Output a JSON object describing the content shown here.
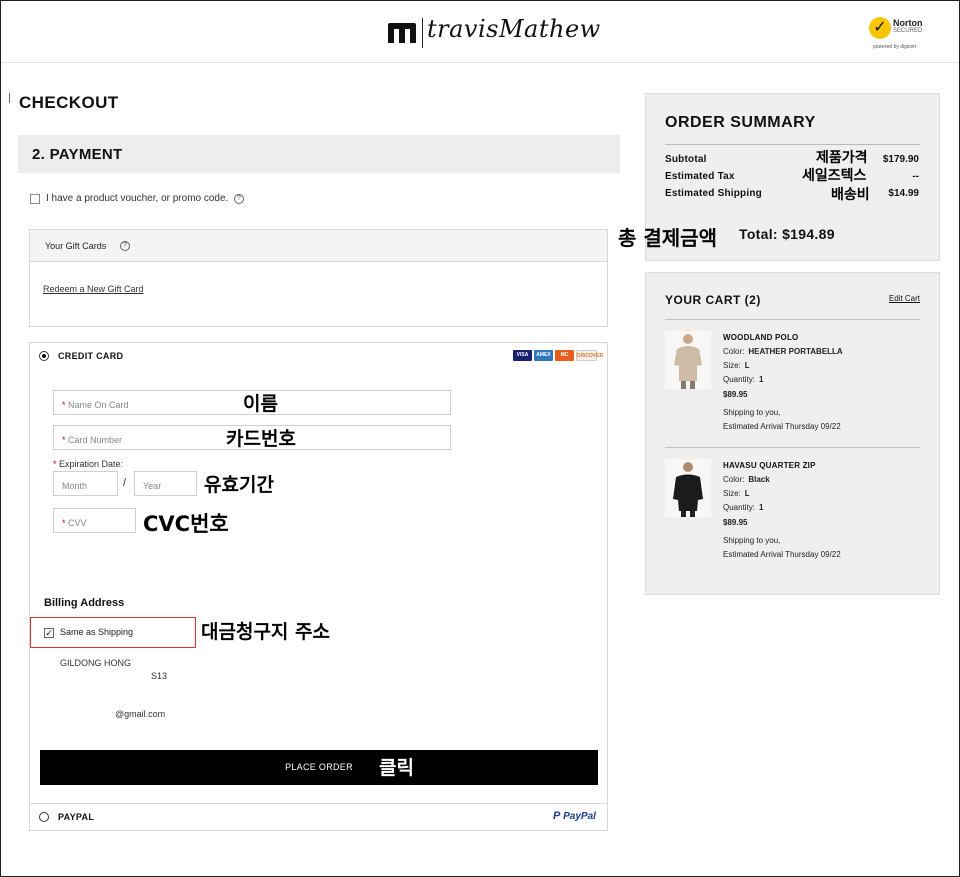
{
  "header": {
    "brand": "travisMathew",
    "norton_badge": {
      "line1": "Norton",
      "line2": "SECURED",
      "powered": "powered by digicert"
    },
    "accent_color": "#f7c600"
  },
  "checkout": {
    "title": "CHECKOUT",
    "step_title": "2. PAYMENT",
    "promo_label": "I have a product voucher, or promo code.",
    "gift_cards": {
      "header": "Your Gift Cards",
      "redeem_link": "Redeem a New Gift Card"
    },
    "credit_card": {
      "label": "CREDIT CARD",
      "selected": true,
      "card_brands": [
        "VISA",
        "AMEX",
        "MC",
        "DISCOVER"
      ],
      "fields": {
        "name_placeholder": "Name On Card",
        "number_placeholder": "Card Number",
        "expiration_label": "Expiration Date:",
        "month_placeholder": "Month",
        "year_placeholder": "Year",
        "date_separator": "/",
        "cvv_placeholder": "CVV",
        "required_mark": "*"
      }
    },
    "billing": {
      "title": "Billing Address",
      "same_as_shipping_label": "Same as Shipping",
      "same_as_shipping_checked": true,
      "name": "GILDONG HONG",
      "line2": "S13",
      "email": "@gmail.com"
    },
    "place_order_label": "PLACE ORDER",
    "paypal": {
      "label": "PAYPAL",
      "logo_text": "PayPal",
      "selected": false
    }
  },
  "annotations": {
    "name": "이름",
    "card_number": "카드번호",
    "expiry": "유효기간",
    "cvc": "CVC번호",
    "billing_address": "대금청구지 주소",
    "click": "클릭",
    "product_price": "제품가격",
    "sales_tax": "세일즈텍스",
    "shipping_fee": "배송비",
    "total_amount": "총 결제금액"
  },
  "order_summary": {
    "title": "ORDER SUMMARY",
    "subtotal_label": "Subtotal",
    "subtotal_value": "$179.90",
    "tax_label": "Estimated Tax",
    "tax_value": "--",
    "shipping_label": "Estimated Shipping",
    "shipping_value": "$14.99",
    "total_label": "Total:",
    "total_value": "$194.89"
  },
  "cart": {
    "title": "YOUR CART (2)",
    "edit_label": "Edit Cart",
    "items": [
      {
        "name": "WOODLAND POLO",
        "color_label": "Color:",
        "color": "HEATHER PORTABELLA",
        "size_label": "Size:",
        "size": "L",
        "qty_label": "Quantity:",
        "qty": "1",
        "price": "$89.95",
        "shipping": "Shipping to you,",
        "arrival": "Estimated Arrival Thursday 09/22"
      },
      {
        "name": "HAVASU QUARTER ZIP",
        "color_label": "Color:",
        "color": "Black",
        "size_label": "Size:",
        "size": "L",
        "qty_label": "Quantity:",
        "qty": "1",
        "price": "$89.95",
        "shipping": "Shipping to you,",
        "arrival": "Estimated Arrival Thursday 09/22"
      }
    ]
  }
}
